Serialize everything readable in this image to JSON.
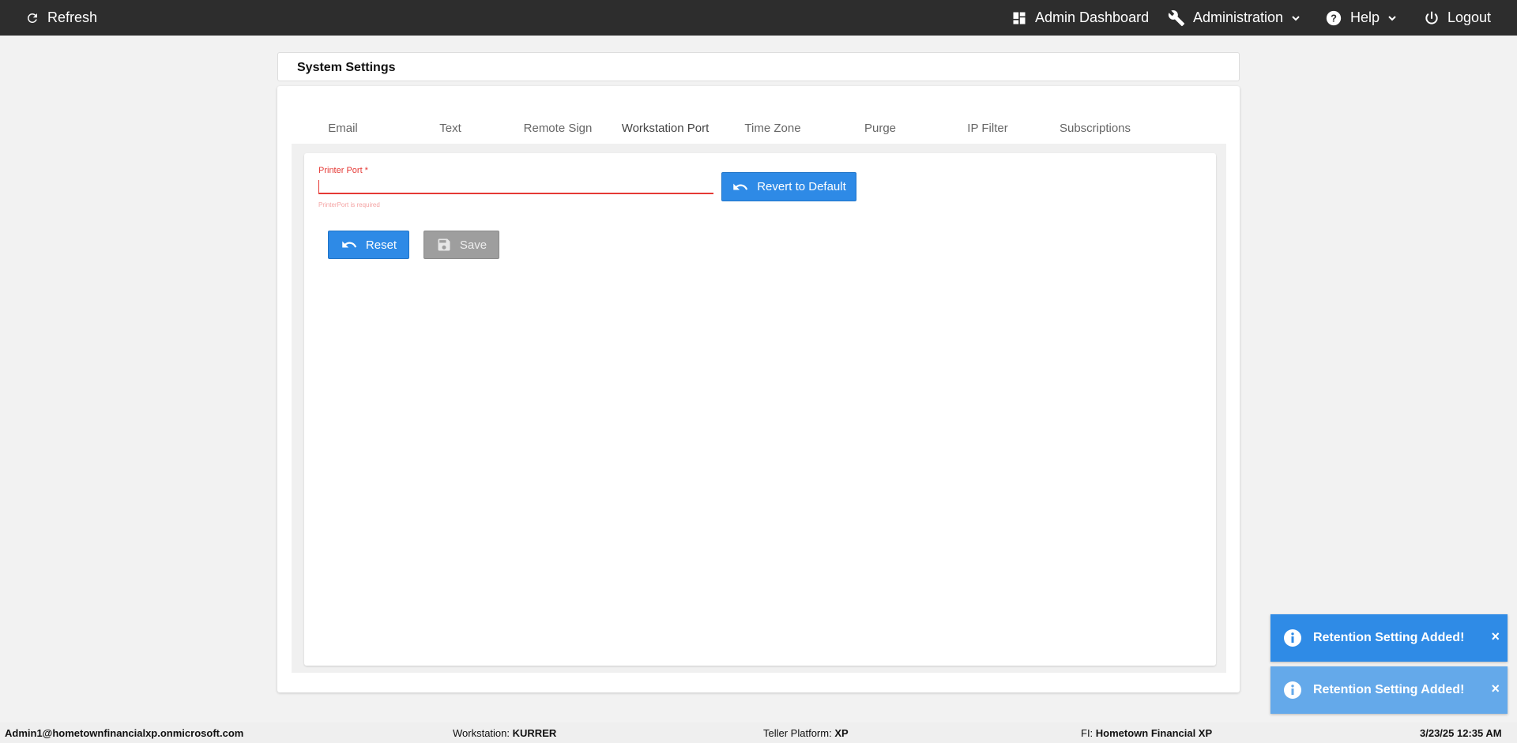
{
  "topbar": {
    "refresh_label": "Refresh",
    "admin_dashboard_label": "Admin Dashboard",
    "administration_label": "Administration",
    "help_label": "Help",
    "logout_label": "Logout"
  },
  "header": {
    "title": "System Settings"
  },
  "tabs": [
    {
      "label": "Email"
    },
    {
      "label": "Text"
    },
    {
      "label": "Remote Sign"
    },
    {
      "label": "Workstation Port",
      "active": true
    },
    {
      "label": "Time Zone"
    },
    {
      "label": "Purge"
    },
    {
      "label": "IP Filter"
    },
    {
      "label": "Subscriptions"
    }
  ],
  "form": {
    "printer_port_label": "Printer Port *",
    "printer_port_value": "",
    "printer_port_error": "PrinterPort is required",
    "revert_label": "Revert to Default",
    "reset_label": "Reset",
    "save_label": "Save"
  },
  "toasts": [
    {
      "message": "Retention Setting Added!",
      "close": "×"
    },
    {
      "message": "Retention Setting Added!",
      "close": "×"
    }
  ],
  "status": {
    "user": "Admin1@hometownfinancialxp.onmicrosoft.com",
    "workstation_label": "Workstation:",
    "workstation_value": "KURRER",
    "teller_label": "Teller Platform:",
    "teller_value": "XP",
    "fi_label": "FI:",
    "fi_value": "Hometown Financial XP",
    "datetime": "3/23/25 12:35 AM"
  },
  "colors": {
    "topbar": "#2d2d2d",
    "primary_button": "#2e8ae6",
    "disabled_button": "#9e9e9e",
    "error": "#e53935",
    "active_tab_indicator": "#3f51b5"
  }
}
